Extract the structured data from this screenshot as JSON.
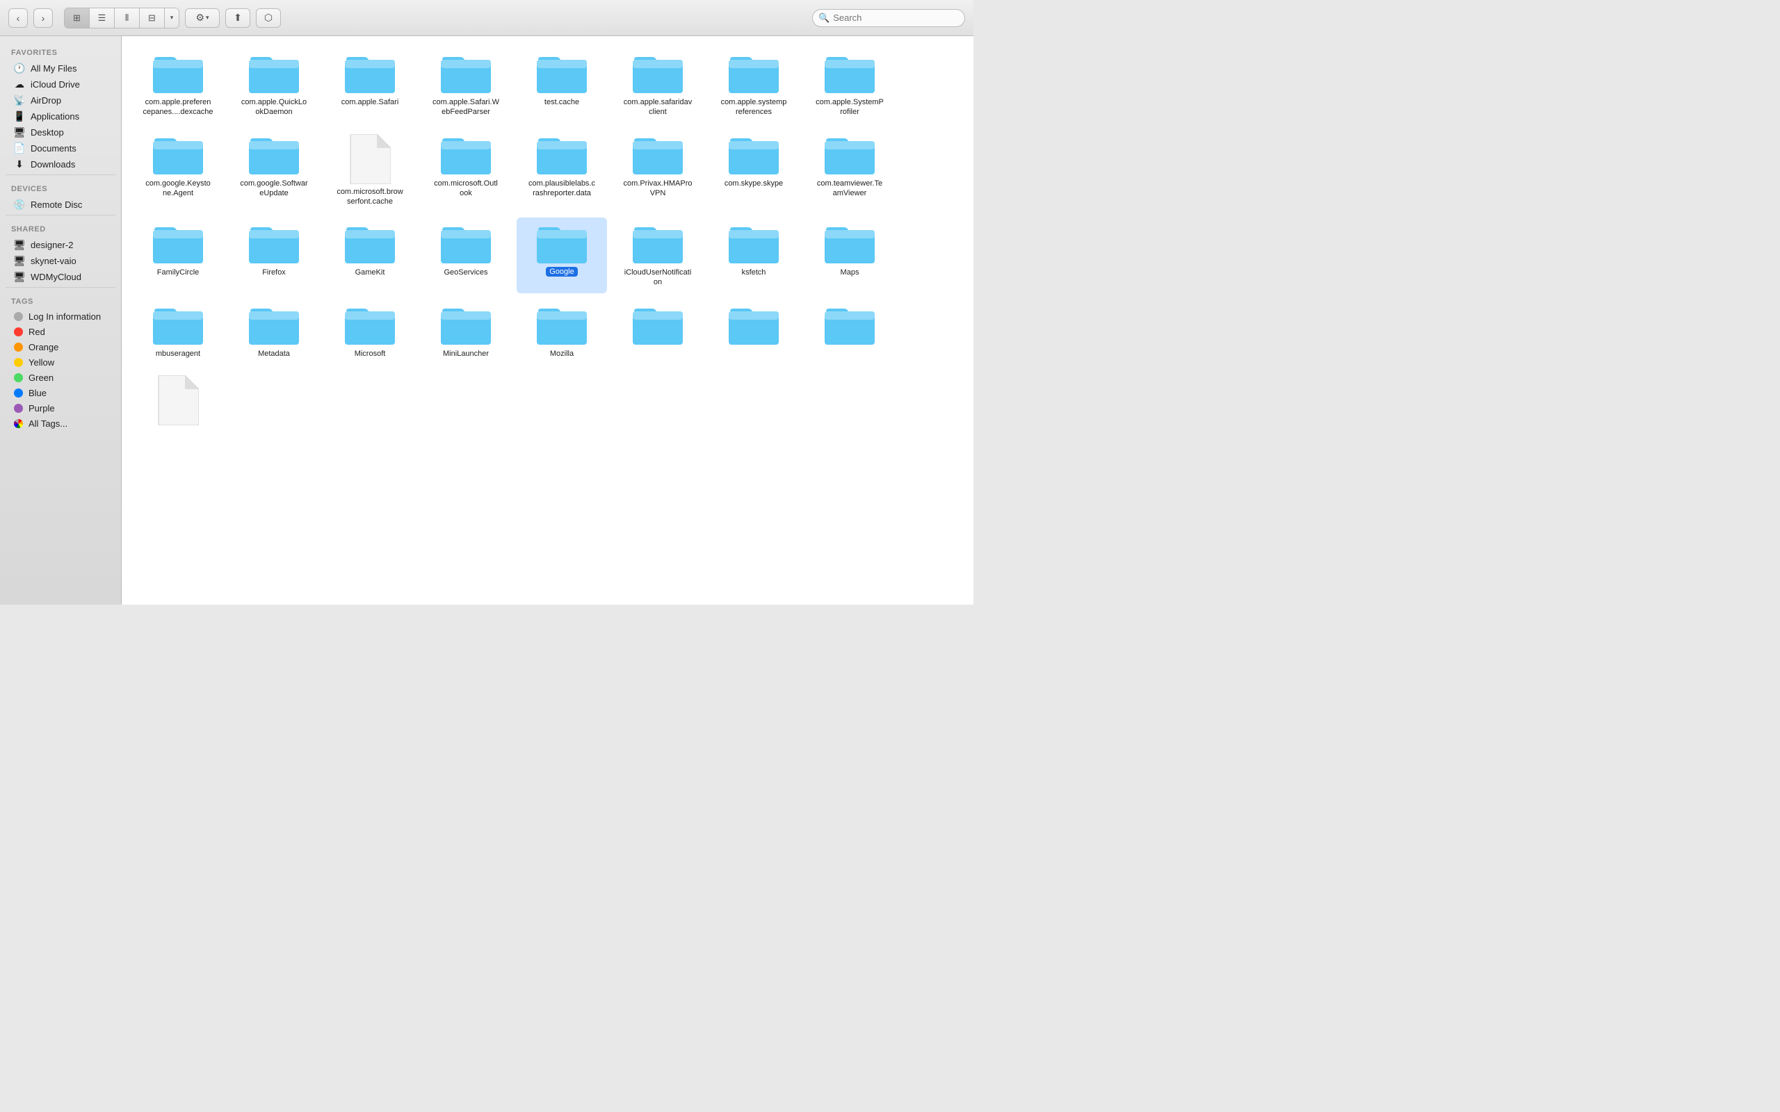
{
  "toolbar": {
    "back_label": "‹",
    "forward_label": "›",
    "view_icon": "⊞",
    "view_list": "≡",
    "view_columns": "⫴",
    "view_cover": "⊟",
    "view_grid_dropdown": "▾",
    "action_gear": "⚙",
    "action_gear_dropdown": "▾",
    "action_share": "↑",
    "action_label": "⬡",
    "search_placeholder": "Search"
  },
  "sidebar": {
    "favorites_header": "Favorites",
    "devices_header": "Devices",
    "shared_header": "Shared",
    "tags_header": "Tags",
    "favorites": [
      {
        "id": "all-my-files",
        "label": "All My Files",
        "icon": "🕐"
      },
      {
        "id": "icloud-drive",
        "label": "iCloud Drive",
        "icon": "☁"
      },
      {
        "id": "airdrop",
        "label": "AirDrop",
        "icon": "📡"
      },
      {
        "id": "applications",
        "label": "Applications",
        "icon": "📱"
      },
      {
        "id": "desktop",
        "label": "Desktop",
        "icon": "🖥"
      },
      {
        "id": "documents",
        "label": "Documents",
        "icon": "📄"
      },
      {
        "id": "downloads",
        "label": "Downloads",
        "icon": "⬇"
      }
    ],
    "devices": [
      {
        "id": "remote-disc",
        "label": "Remote Disc",
        "icon": "💿"
      }
    ],
    "shared": [
      {
        "id": "designer-2",
        "label": "designer-2",
        "icon": "🖥"
      },
      {
        "id": "skynet-vaio",
        "label": "skynet-vaio",
        "icon": "🖥"
      },
      {
        "id": "wdmycloud",
        "label": "WDMyCloud",
        "icon": "🖥"
      }
    ],
    "tags": [
      {
        "id": "log-in-information",
        "label": "Log In information",
        "color": "#aaa"
      },
      {
        "id": "red",
        "label": "Red",
        "color": "#ff3b30"
      },
      {
        "id": "orange",
        "label": "Orange",
        "color": "#ff9500"
      },
      {
        "id": "yellow",
        "label": "Yellow",
        "color": "#ffcc00"
      },
      {
        "id": "green",
        "label": "Green",
        "color": "#4cd964"
      },
      {
        "id": "blue",
        "label": "Blue",
        "color": "#007aff"
      },
      {
        "id": "purple",
        "label": "Purple",
        "color": "#9b59b6"
      },
      {
        "id": "all-tags",
        "label": "All Tags...",
        "color": "#aaa"
      }
    ]
  },
  "files": [
    {
      "id": "com-apple-prefcepanes-dexcache",
      "name": "com.apple.preferen\ncepanes....dexcache",
      "type": "folder",
      "selected": false
    },
    {
      "id": "com-apple-quicklookdaemon",
      "name": "com.apple.QuickLo\nokDaemon",
      "type": "folder",
      "selected": false
    },
    {
      "id": "com-apple-safari",
      "name": "com.apple.Safari",
      "type": "folder",
      "selected": false
    },
    {
      "id": "com-apple-safari-webfeedparser",
      "name": "com.apple.Safari.W\nebFeedParser",
      "type": "folder",
      "selected": false
    },
    {
      "id": "test-cache",
      "name": "test.cache",
      "type": "folder",
      "selected": false
    },
    {
      "id": "com-apple-safaridavclient",
      "name": "com.apple.safaridav\nclient",
      "type": "folder",
      "selected": false
    },
    {
      "id": "com-apple-systempreferences",
      "name": "com.apple.systemp\nreferences",
      "type": "folder",
      "selected": false
    },
    {
      "id": "com-apple-systemprofiler",
      "name": "com.apple.SystemP\nrofiler",
      "type": "folder",
      "selected": false
    },
    {
      "id": "com-google-keystoneagent",
      "name": "com.google.Keysto\nne.Agent",
      "type": "folder",
      "selected": false
    },
    {
      "id": "com-google-softwareupdate",
      "name": "com.google.Softwar\neUpdate",
      "type": "folder",
      "selected": false
    },
    {
      "id": "com-microsoft-browserfontcache",
      "name": "com.microsoft.brow\nserfont.cache",
      "type": "doc",
      "selected": false
    },
    {
      "id": "com-microsoft-outlook",
      "name": "com.microsoft.Outl\nook",
      "type": "folder",
      "selected": false
    },
    {
      "id": "com-plausiblelabs-crashreporter",
      "name": "com.plausiblelabs.c\nrashreporter.data",
      "type": "folder",
      "selected": false
    },
    {
      "id": "com-privax-hmaprovpn",
      "name": "com.Privax.HMAPro\nVPN",
      "type": "folder",
      "selected": false
    },
    {
      "id": "com-skype-skype",
      "name": "com.skype.skype",
      "type": "folder",
      "selected": false
    },
    {
      "id": "com-teamviewer-teamviewer",
      "name": "com.teamviewer.Te\namViewer",
      "type": "folder",
      "selected": false
    },
    {
      "id": "familycircle",
      "name": "FamilyCircle",
      "type": "folder",
      "selected": false
    },
    {
      "id": "firefox",
      "name": "Firefox",
      "type": "folder",
      "selected": false
    },
    {
      "id": "gamekit",
      "name": "GameKit",
      "type": "folder",
      "selected": false
    },
    {
      "id": "geoservices",
      "name": "GeoServices",
      "type": "folder",
      "selected": false
    },
    {
      "id": "google",
      "name": "Google",
      "type": "folder",
      "selected": true
    },
    {
      "id": "icloudnotifications",
      "name": "iCloudUserNotificati\non",
      "type": "folder",
      "selected": false
    },
    {
      "id": "ksfetch",
      "name": "ksfetch",
      "type": "folder",
      "selected": false
    },
    {
      "id": "maps",
      "name": "Maps",
      "type": "folder",
      "selected": false
    },
    {
      "id": "mbuseragent",
      "name": "mbuseragent",
      "type": "folder",
      "selected": false
    },
    {
      "id": "metadata",
      "name": "Metadata",
      "type": "folder",
      "selected": false
    },
    {
      "id": "microsoft",
      "name": "Microsoft",
      "type": "folder",
      "selected": false
    },
    {
      "id": "minilauncher",
      "name": "MiniLauncher",
      "type": "folder",
      "selected": false
    },
    {
      "id": "mozilla",
      "name": "Mozilla",
      "type": "folder",
      "selected": false
    },
    {
      "id": "folder-bottom-1",
      "name": "",
      "type": "folder",
      "selected": false
    },
    {
      "id": "folder-bottom-2",
      "name": "",
      "type": "folder",
      "selected": false
    },
    {
      "id": "folder-bottom-3",
      "name": "",
      "type": "folder",
      "selected": false
    },
    {
      "id": "doc-bottom",
      "name": "",
      "type": "doc",
      "selected": false
    }
  ],
  "accent_color": "#007aff",
  "selected_badge_color": "#1d6fe5"
}
